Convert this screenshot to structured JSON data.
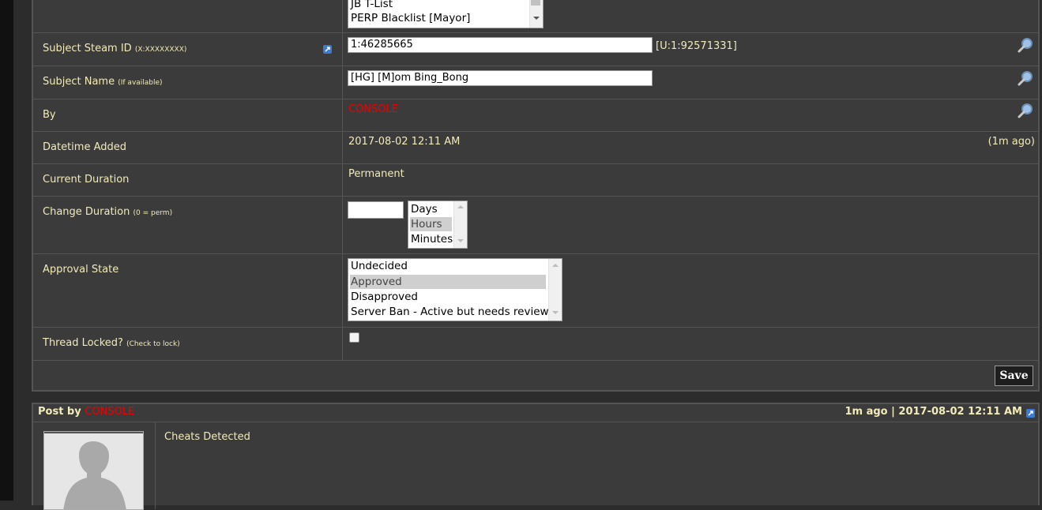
{
  "groups_list": {
    "options": [
      "JB T-List",
      "PERP Blacklist [Mayor]"
    ]
  },
  "subject_steam_id": {
    "label": "Subject Steam ID",
    "hint": "(X:XXXXXXXX)",
    "value": "1:46285665",
    "converted": "[U:1:92571331]"
  },
  "subject_name": {
    "label": "Subject Name",
    "hint": "(If available)",
    "value": "[HG] [M]om Bing_Bong"
  },
  "by": {
    "label": "By",
    "value": "CONSOLE"
  },
  "datetime_added": {
    "label": "Datetime Added",
    "value": "2017-08-02 12:11 AM",
    "relative": "(1m ago)"
  },
  "current_duration": {
    "label": "Current Duration",
    "value": "Permanent"
  },
  "change_duration": {
    "label": "Change Duration",
    "hint": "(0 = perm)",
    "value": "",
    "units": [
      "Days",
      "Hours",
      "Minutes"
    ],
    "selected_unit": "Hours"
  },
  "approval_state": {
    "label": "Approval State",
    "options": [
      "Undecided",
      "Approved",
      "Disapproved",
      "Server Ban - Active but needs review"
    ],
    "selected": "Approved"
  },
  "thread_locked": {
    "label": "Thread Locked?",
    "hint": "(Check to lock)",
    "checked": false
  },
  "save_label": "Save",
  "post": {
    "title_prefix": "Post by",
    "author": "CONSOLE",
    "meta": "1m ago | 2017-08-02 12:11 AM",
    "body": "Cheats Detected"
  },
  "colors": {
    "label_text": "#f2eab8",
    "console_red": "#e00000",
    "panel_bg": "#3b3b3b"
  }
}
